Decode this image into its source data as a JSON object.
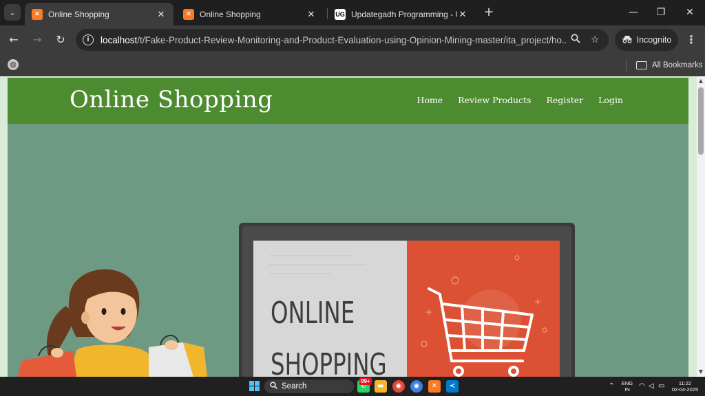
{
  "tabs": [
    {
      "title": "Online Shopping",
      "active": true,
      "favicon": "xampp-icon"
    },
    {
      "title": "Online Shopping",
      "active": false,
      "favicon": "xampp-icon"
    },
    {
      "title": "Updategadh Programming - Upda",
      "active": false,
      "favicon": "updategadh-icon"
    }
  ],
  "omnibox": {
    "host": "localhost",
    "path": "/t/Fake-Product-Review-Monitoring-and-Product-Evaluation-using-Opinion-Mining-master/ita_project/ho..."
  },
  "incognito_label": "Incognito",
  "bookmarks": {
    "all_label": "All Bookmarks"
  },
  "site": {
    "title": "Online Shopping",
    "nav": [
      "Home",
      "Review Products",
      "Register",
      "Login"
    ],
    "hero_text_line1": "ONLINE",
    "hero_text_line2": "SHOPPING"
  },
  "colors": {
    "header_green": "#4d8b31",
    "hero_bg": "#6e9a84",
    "monitor_red": "#dc5033"
  },
  "taskbar": {
    "search_label": "Search",
    "badge": "99+",
    "lang_line1": "ENG",
    "lang_line2": "IN",
    "time": "11:22",
    "date": "02-04-2025"
  }
}
